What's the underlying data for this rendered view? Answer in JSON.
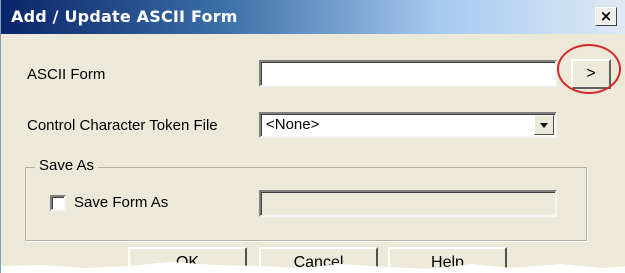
{
  "window": {
    "title": "Add / Update ASCII Form",
    "close_label": "×"
  },
  "fields": {
    "ascii_form_label": "ASCII Form",
    "ascii_form_value": "",
    "browse_label": ">",
    "token_file_label": "Control Character Token File",
    "token_file_value": "<None>"
  },
  "save_as": {
    "group_label": "Save As",
    "checkbox_label": "Save Form As",
    "checked": false,
    "value": ""
  },
  "buttons": {
    "ok": "OK",
    "cancel": "Cancel",
    "help": "Help"
  },
  "colors": {
    "titlebar_start": "#0a246a",
    "dialog_bg": "#ece9d8",
    "highlight_ring": "#d62a2a"
  }
}
